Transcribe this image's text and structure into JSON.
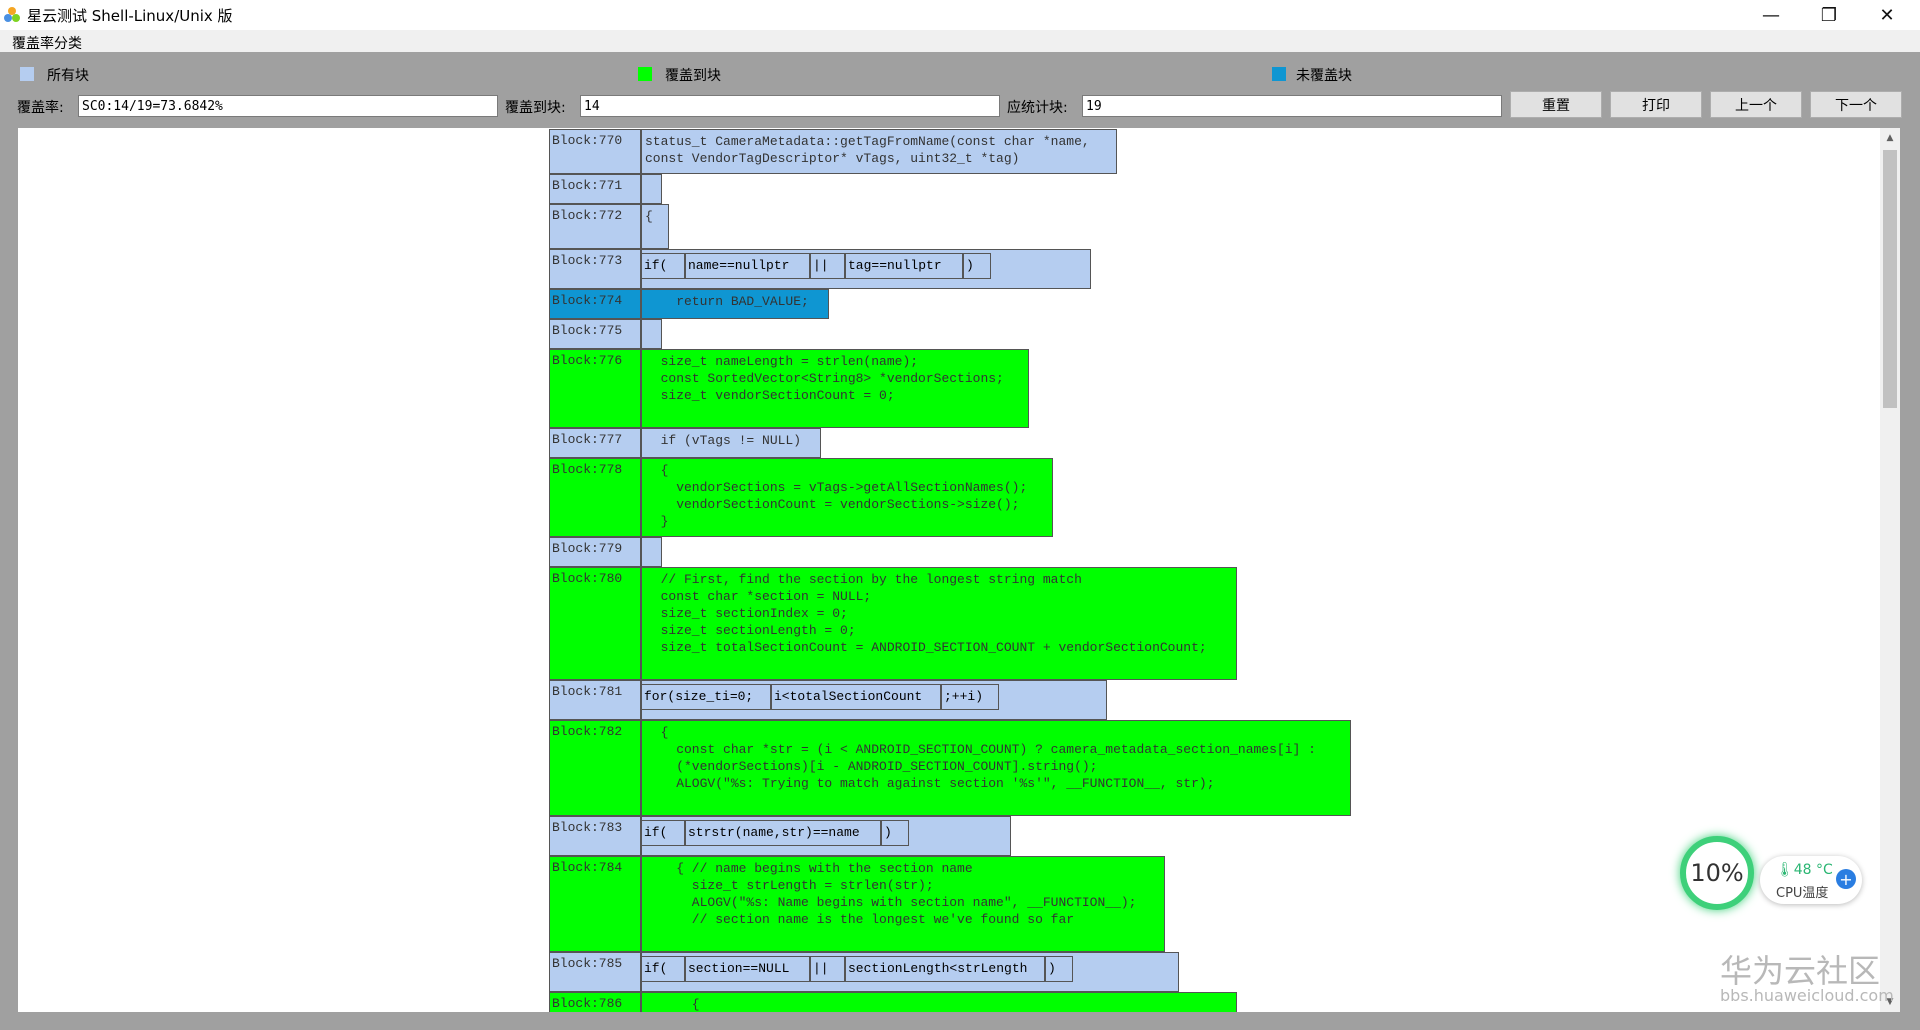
{
  "window": {
    "title": "星云测试 Shell-Linux/Unix 版",
    "minimize": "—",
    "maximize": "❐",
    "close": "✕"
  },
  "menu": {
    "item1": "覆盖率分类"
  },
  "legend": {
    "all": "所有块",
    "covered": "覆盖到块",
    "uncovered": "未覆盖块",
    "color_all": "#b5cdf0",
    "color_covered": "#00ff00",
    "color_uncovered": "#0f96d2"
  },
  "fields": {
    "coverage_label": "覆盖率:",
    "coverage_value": "SC0:14/19=73.6842%",
    "covered_label": "覆盖到块:",
    "covered_value": "14",
    "total_label": "应统计块:",
    "total_value": "19"
  },
  "buttons": {
    "reset": "重置",
    "print": "打印",
    "prev": "上一个",
    "next": "下一个"
  },
  "blocks": [
    {
      "label": "Block:770",
      "status": "all",
      "code": "status_t CameraMetadata::getTagFromName(const char *name,\nconst VendorTagDescriptor* vTags, uint32_t *tag)"
    },
    {
      "label": "Block:771",
      "status": "all",
      "code": ""
    },
    {
      "label": "Block:772",
      "status": "all",
      "code": "{"
    },
    {
      "label": "Block:773",
      "status": "all",
      "segments": [
        "if(",
        "name==nullptr",
        "||",
        "tag==nullptr",
        ")"
      ]
    },
    {
      "label": "Block:774",
      "status": "uncovered",
      "code": "    return BAD_VALUE;"
    },
    {
      "label": "Block:775",
      "status": "all",
      "code": ""
    },
    {
      "label": "Block:776",
      "status": "covered",
      "code": "  size_t nameLength = strlen(name);\n  const SortedVector<String8> *vendorSections;\n  size_t vendorSectionCount = 0;"
    },
    {
      "label": "Block:777",
      "status": "all",
      "code": "  if (vTags != NULL)"
    },
    {
      "label": "Block:778",
      "status": "covered",
      "code": "  {\n    vendorSections = vTags->getAllSectionNames();\n    vendorSectionCount = vendorSections->size();\n  }"
    },
    {
      "label": "Block:779",
      "status": "all",
      "code": ""
    },
    {
      "label": "Block:780",
      "status": "covered",
      "code": "  // First, find the section by the longest string match\n  const char *section = NULL;\n  size_t sectionIndex = 0;\n  size_t sectionLength = 0;\n  size_t totalSectionCount = ANDROID_SECTION_COUNT + vendorSectionCount;"
    },
    {
      "label": "Block:781",
      "status": "all",
      "segments": [
        "for(size_ti=0;",
        "i<totalSectionCount",
        ";++i)"
      ]
    },
    {
      "label": "Block:782",
      "status": "covered",
      "code": "  {\n    const char *str = (i < ANDROID_SECTION_COUNT) ? camera_metadata_section_names[i] :\n    (*vendorSections)[i - ANDROID_SECTION_COUNT].string();\n    ALOGV(\"%s: Trying to match against section '%s'\", __FUNCTION__, str);"
    },
    {
      "label": "Block:783",
      "status": "all",
      "segments": [
        "if(",
        "strstr(name,str)==name",
        ")"
      ]
    },
    {
      "label": "Block:784",
      "status": "covered",
      "code": "    { // name begins with the section name\n      size_t strLength = strlen(str);\n      ALOGV(\"%s: Name begins with section name\", __FUNCTION__);\n      // section name is the longest we've found so far"
    },
    {
      "label": "Block:785",
      "status": "all",
      "segments": [
        "if(",
        "section==NULL",
        "||",
        "sectionLength<strLength",
        ")"
      ]
    },
    {
      "label": "Block:786",
      "status": "covered",
      "code": "      {"
    }
  ],
  "cpu_widget": {
    "percent": "10%",
    "temp": "🌡48 °C",
    "label": "CPU温度"
  },
  "watermark": {
    "line1": "华为云社区",
    "line2": "bbs.huaweicloud.com"
  }
}
